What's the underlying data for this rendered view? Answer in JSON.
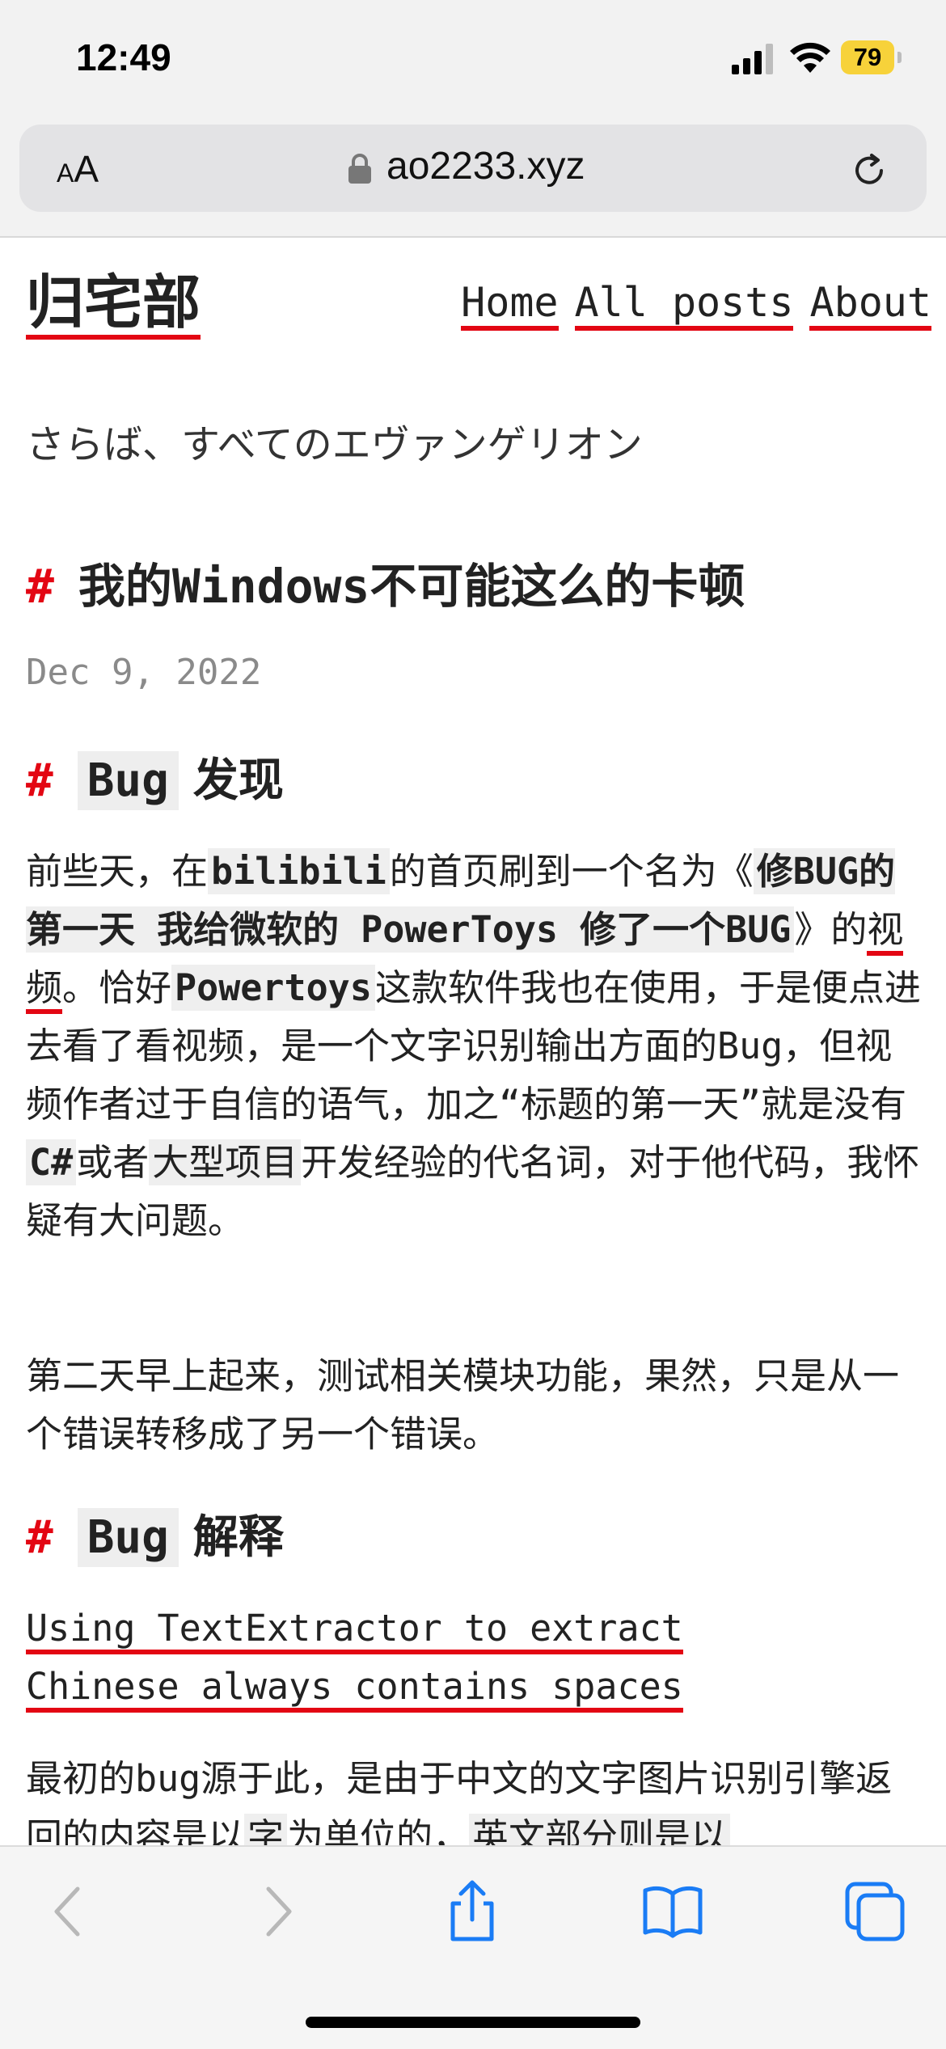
{
  "status_bar": {
    "time": "12:49",
    "battery": "79"
  },
  "address_bar": {
    "text_size_label": "AA",
    "domain": "ao2233.xyz"
  },
  "site": {
    "title": "归宅部",
    "nav": [
      "Home",
      "All posts",
      "About"
    ],
    "tagline": "さらば、すべてのエヴァンゲリオン"
  },
  "post": {
    "title": "我的Windows不可能这么的卡顿",
    "date": "Dec 9, 2022",
    "section1": {
      "code": "Bug",
      "text": "发现"
    },
    "p1": {
      "t1": "前些天，在",
      "c1": "bilibili",
      "t2": "的首页刷到一个名为《",
      "c2": "修BUG的第一天 我给微软的 PowerToys 修了一个BUG",
      "t3": "》的",
      "link": "视频",
      "t4": "。恰好",
      "c3": "Powertoys",
      "t5": "这款软件我也在使用，于是便点进去看了看视频，是一个文字识别输出方面的Bug，但视频作者过于自信的语气，加之“标题的第一天”就是没有",
      "c4": "C#",
      "t6": "或者",
      "c5": "大型项目",
      "t7": "开发经验的代名词，对于他代码，我怀疑有大问题。"
    },
    "p2": "第二天早上起来，测试相关模块功能，果然，只是从一个错误转移成了另一个错误。",
    "section2": {
      "code": "Bug",
      "text": "解释"
    },
    "issue_link": "Using TextExtractor to extract Chinese always contains spaces",
    "p3": {
      "t1": "最初的bug源于此，是由于中文的文字图片识别引擎返回的内容是以",
      "c1": "字",
      "t2": "为单位的，",
      "c2": "英文部分则是以"
    }
  }
}
